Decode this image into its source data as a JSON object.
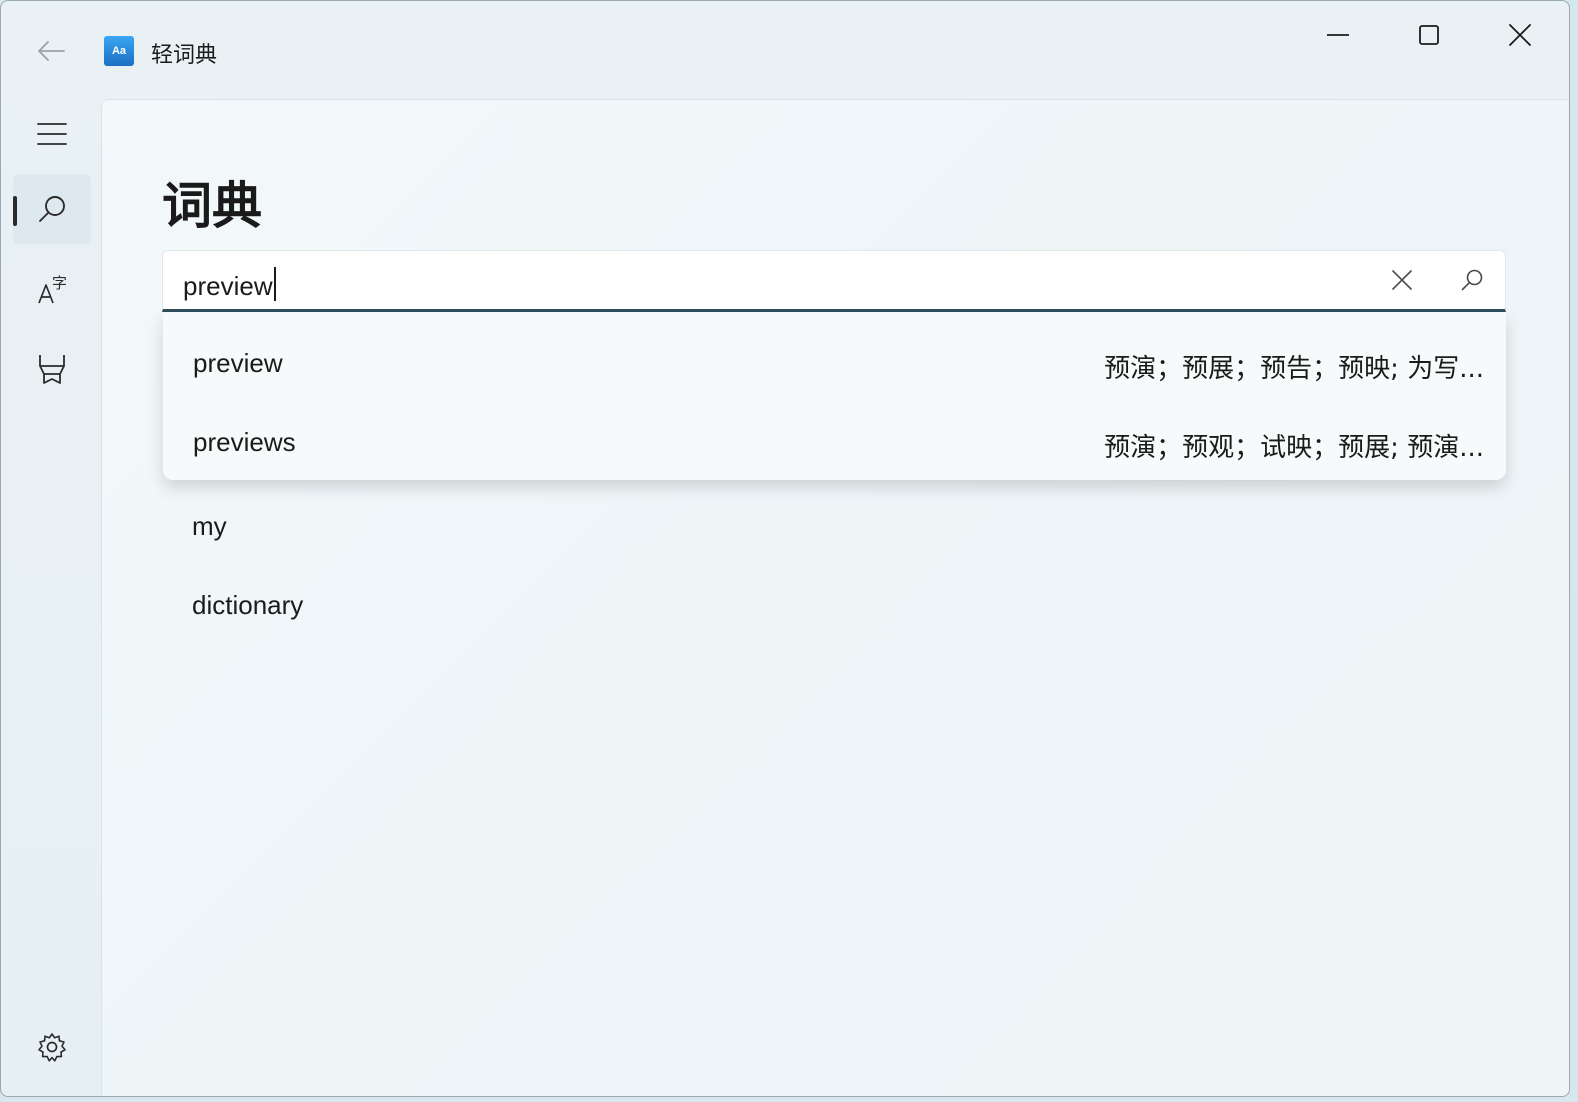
{
  "app": {
    "title": "轻词典",
    "icon_text": "Aa"
  },
  "page": {
    "title": "词典"
  },
  "search": {
    "value": "preview"
  },
  "suggestions": [
    {
      "word": "preview",
      "definition": "预演；预展；预告；预映; 为写..."
    },
    {
      "word": "previews",
      "definition": "预演；预观；试映；预展; 预演..."
    }
  ],
  "history": [
    "my",
    "dictionary"
  ],
  "icons": {
    "back": "back-arrow-icon",
    "minimize": "minimize-icon",
    "maximize": "maximize-icon",
    "close": "close-icon",
    "menu": "hamburger-menu-icon",
    "search": "search-icon",
    "translate": "translate-icon",
    "wordbook": "wordbook-icon",
    "settings": "gear-icon",
    "clear": "clear-icon"
  },
  "colors": {
    "accent_underline": "#2f4e5c",
    "app_icon": "#1b6fc4"
  }
}
